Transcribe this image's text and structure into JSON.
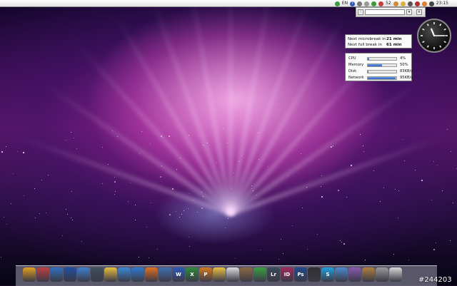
{
  "menubar": {
    "apple": "",
    "language": "EN",
    "help": "?",
    "number": "52",
    "time": "23:15"
  },
  "search_widget": {
    "placeholder": ""
  },
  "break_widget": {
    "rows": [
      {
        "label": "Next microbreak in",
        "value": "21 min"
      },
      {
        "label": "Next full break in",
        "value": "61 min"
      }
    ]
  },
  "system_monitor": {
    "rows": [
      {
        "label": "CPU",
        "value": "4%",
        "level": 0.04
      },
      {
        "label": "Memory",
        "value": "50%",
        "level": 0.5
      },
      {
        "label": "Disk",
        "value": "83KB/s",
        "level": 0.02
      },
      {
        "label": "Network",
        "value": "95KB/s",
        "level": 0.98
      }
    ]
  },
  "clock": {
    "hours": 11,
    "minutes": 15
  },
  "dock": {
    "icons": [
      {
        "name": "finder",
        "glyph": "",
        "color": "#e0a020"
      },
      {
        "name": "pencil",
        "glyph": "",
        "color": "#c04040"
      },
      {
        "name": "itunes",
        "glyph": "",
        "color": "#3070c0"
      },
      {
        "name": "media-player",
        "glyph": "",
        "color": "#2050a0"
      },
      {
        "name": "network",
        "glyph": "",
        "color": "#4080d0"
      },
      {
        "name": "display",
        "glyph": "",
        "color": "#405060"
      },
      {
        "name": "folder",
        "glyph": "",
        "color": "#e8c040"
      },
      {
        "name": "safari",
        "glyph": "",
        "color": "#3a8ad8"
      },
      {
        "name": "internet-explorer",
        "glyph": "",
        "color": "#2f7ad0"
      },
      {
        "name": "firefox",
        "glyph": "",
        "color": "#e07020"
      },
      {
        "name": "thunderbird",
        "glyph": "",
        "color": "#4070b0"
      },
      {
        "name": "word",
        "glyph": "W",
        "color": "#2d5bb5"
      },
      {
        "name": "excel",
        "glyph": "X",
        "color": "#2e8b3a"
      },
      {
        "name": "powerpoint",
        "glyph": "P",
        "color": "#d47a20"
      },
      {
        "name": "folder-2",
        "glyph": "",
        "color": "#e8c040"
      },
      {
        "name": "document",
        "glyph": "",
        "color": "#dcdcdc"
      },
      {
        "name": "gimp",
        "glyph": "",
        "color": "#8a6a40"
      },
      {
        "name": "utorrent",
        "glyph": "",
        "color": "#3aa040"
      },
      {
        "name": "lightroom",
        "glyph": "Lr",
        "color": "#3a4a55"
      },
      {
        "name": "indesign",
        "glyph": "ID",
        "color": "#a02a5a"
      },
      {
        "name": "photoshop",
        "glyph": "Ps",
        "color": "#1f4a8a"
      },
      {
        "name": "camera",
        "glyph": "",
        "color": "#303030"
      },
      {
        "name": "skype",
        "glyph": "S",
        "color": "#1da1e0"
      },
      {
        "name": "contacts",
        "glyph": "",
        "color": "#4a8ad0"
      },
      {
        "name": "user",
        "glyph": "",
        "color": "#8a5ab0"
      },
      {
        "name": "box",
        "glyph": "",
        "color": "#b08040"
      },
      {
        "name": "trash",
        "glyph": "",
        "color": "#9a9a9a"
      },
      {
        "name": "screen",
        "glyph": "",
        "color": "#d8d8d8"
      }
    ]
  },
  "watermark": "#244203"
}
